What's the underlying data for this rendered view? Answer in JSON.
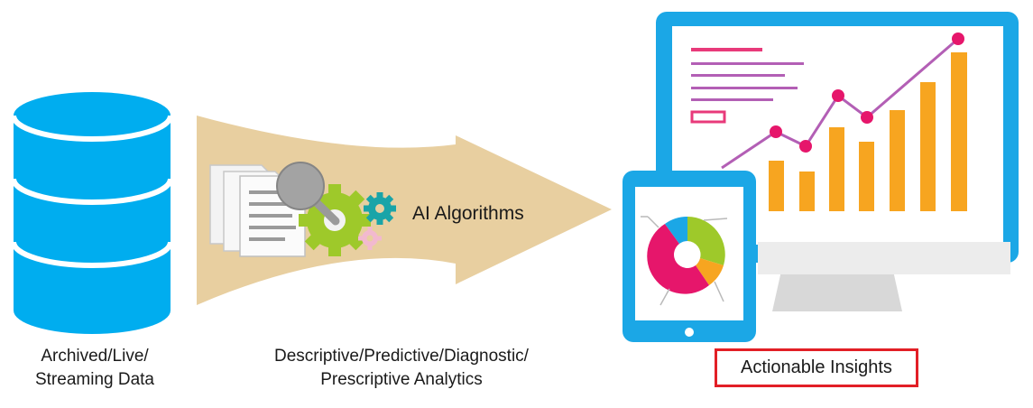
{
  "labels": {
    "data_source_line1": "Archived/Live/",
    "data_source_line2": "Streaming Data",
    "analytics_line1": "Descriptive/Predictive/Diagnostic/",
    "analytics_line2": "Prescriptive Analytics",
    "algorithms": "AI Algorithms",
    "insights": "Actionable Insights"
  },
  "icons": {
    "database": "database-icon",
    "documents": "documents-icon",
    "magnifier": "magnifier-icon",
    "gears": "gears-icon",
    "arrow": "flow-arrow",
    "monitor": "monitor-icon",
    "tablet": "tablet-icon",
    "donut": "donut-chart-icon"
  },
  "colors": {
    "database": "#00adef",
    "arrow": "#e8cfa0",
    "monitor_frame": "#1ba7e6",
    "bars": "#f7a520",
    "trend_line": "#b35fb5",
    "trend_points": "#e6166b",
    "gear_green": "#9ec92a",
    "gear_teal": "#1aa4a8",
    "gear_pink": "#f2b9cf",
    "insights_border": "#e21f26"
  }
}
